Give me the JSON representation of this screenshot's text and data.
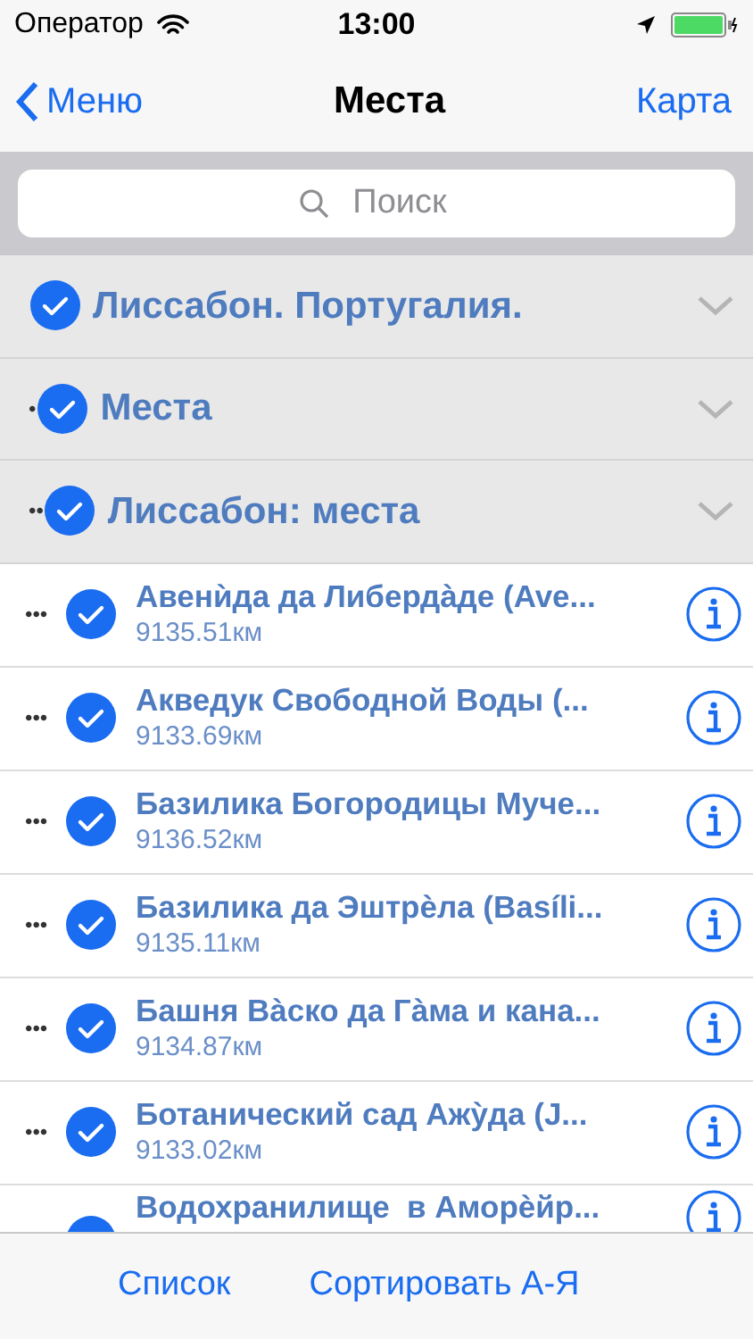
{
  "status_bar": {
    "carrier": "Оператор",
    "time": "13:00"
  },
  "nav": {
    "back": "Меню",
    "title": "Места",
    "action": "Карта"
  },
  "search": {
    "placeholder": "Поиск"
  },
  "tree": [
    {
      "title": "Лиссабон. Португалия.",
      "checked": true,
      "children": [
        {
          "prefix": "•",
          "title": "Места",
          "checked": true,
          "children": [
            {
              "prefix": "••",
              "title": "Лиссабон: места",
              "checked": true,
              "children": [
                {
                  "prefix": "•••",
                  "title": "Авенѝда да Либердàде (Ave...",
                  "distance": "9135.51км",
                  "checked": true
                },
                {
                  "prefix": "•••",
                  "title": "Акведук Свободной Воды (...",
                  "distance": "9133.69км",
                  "checked": true
                },
                {
                  "prefix": "•••",
                  "title": "Базилика Богородицы Муче...",
                  "distance": "9136.52км",
                  "checked": true
                },
                {
                  "prefix": "•••",
                  "title": "Базилика да Эштрѐла (Basíli...",
                  "distance": "9135.11км",
                  "checked": true
                },
                {
                  "prefix": "•••",
                  "title": "Башня Вàско да Гàма и кана...",
                  "distance": "9134.87км",
                  "checked": true
                },
                {
                  "prefix": "•••",
                  "title": "Ботанический сад Ажỳда (J...",
                  "distance": "9133.02км",
                  "checked": true
                },
                {
                  "title": "Водохранилище  в Аморѐйр...",
                  "checked": true
                }
              ]
            }
          ]
        }
      ]
    }
  ],
  "toolbar": [
    "Список",
    "Сортировать А-Я"
  ]
}
